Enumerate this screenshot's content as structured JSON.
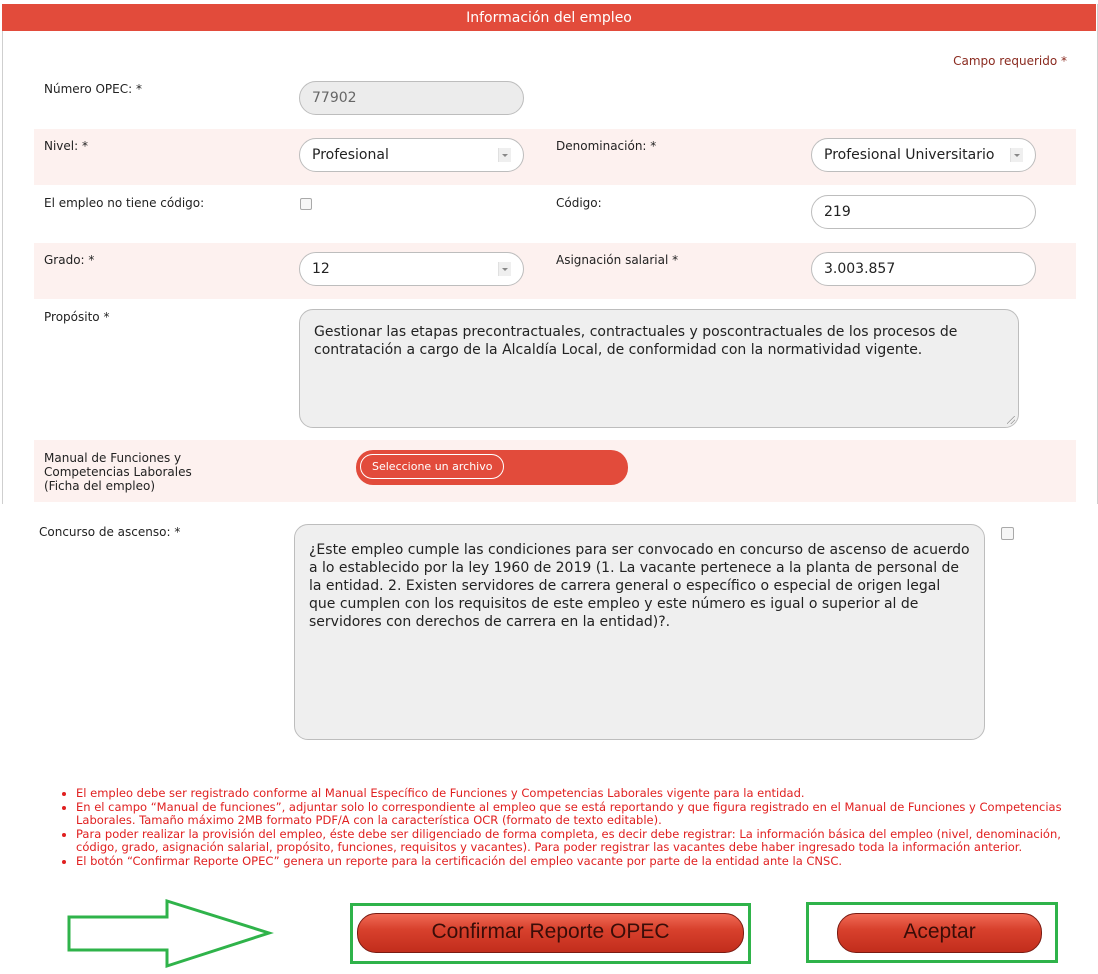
{
  "header": {
    "title": "Información del empleo"
  },
  "required_note": "Campo requerido *",
  "form": {
    "numero_opec": {
      "label": "Número OPEC: *",
      "value": "77902"
    },
    "nivel": {
      "label": "Nivel: *",
      "value": "Profesional"
    },
    "denominacion": {
      "label": "Denominación: *",
      "value": "Profesional Universitario"
    },
    "no_codigo": {
      "label": "El empleo no tiene código:"
    },
    "codigo": {
      "label": "Código:",
      "value": "219"
    },
    "grado": {
      "label": "Grado: *",
      "value": "12"
    },
    "asignacion": {
      "label": "Asignación salarial *",
      "value": "3.003.857"
    },
    "proposito": {
      "label": "Propósito *",
      "value": "Gestionar las etapas precontractuales, contractuales y poscontractuales  de los procesos de contratación a cargo de la Alcaldía Local, de conformidad con la normatividad vigente."
    },
    "manual": {
      "label_lines": [
        "Manual de Funciones y",
        "Competencias Laborales",
        "(Ficha del empleo)"
      ],
      "button_label": "Seleccione un archivo"
    },
    "concurso": {
      "label": "Concurso de ascenso: *",
      "text": "¿Este empleo cumple las condiciones para ser convocado en concurso de ascenso de acuerdo a lo establecido por la ley 1960 de 2019 (1. La vacante pertenece a la planta de personal de la entidad. 2. Existen servidores de carrera general o específico o especial de origen legal que cumplen con los requisitos de este empleo y este número es igual o superior al de servidores con derechos de carrera en la entidad)?."
    }
  },
  "notes": [
    "El empleo debe ser registrado conforme al Manual Específico de Funciones y Competencias Laborales vigente para la entidad.",
    "En el campo “Manual de funciones”, adjuntar solo lo correspondiente al empleo que se está reportando y que figura registrado en el Manual de Funciones y Competencias Laborales. Tamaño máximo 2MB formato PDF/A con la característica OCR (formato de texto editable).",
    "Para poder realizar la provisión del empleo, éste debe ser diligenciado de forma completa, es decir debe registrar: La información básica del empleo (nivel, denominación, código, grado, asignación salarial, propósito, funciones, requisitos y vacantes). Para poder registrar las vacantes debe haber ingresado toda la información anterior.",
    "El botón “Confirmar Reporte OPEC” genera un reporte para la certificación del empleo vacante por parte de la entidad ante la CNSC."
  ],
  "actions": {
    "confirm_label": "Confirmar Reporte OPEC",
    "accept_label": "Aceptar"
  },
  "colors": {
    "header": "#e24b3b",
    "stripe": "#fdf1ef",
    "notes": "#e02020",
    "highlight": "#2fb34a"
  },
  "icons": {
    "annotation_arrow": "arrow-right-icon"
  }
}
